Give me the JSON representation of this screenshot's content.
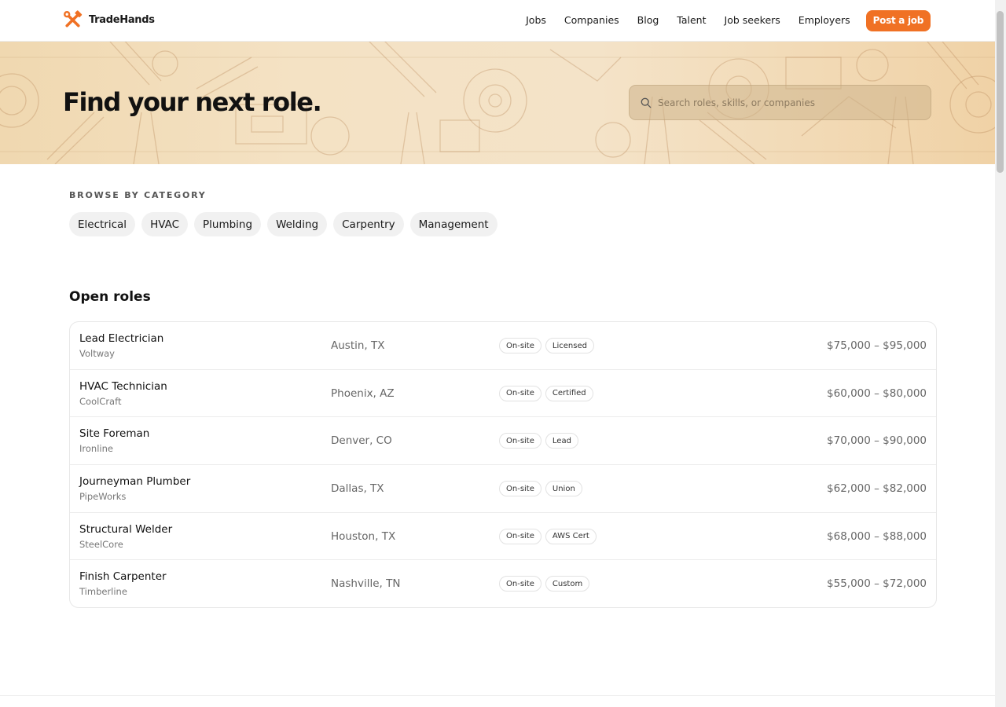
{
  "brand": {
    "name": "TradeHands",
    "accent": "#f07124"
  },
  "nav": {
    "links": [
      "Jobs",
      "Companies",
      "Blog",
      "Talent",
      "Job seekers",
      "Employers"
    ],
    "cta_label": "Post a job"
  },
  "hero": {
    "title": "Find your next role.",
    "search_placeholder": "Search roles, skills, or companies"
  },
  "categories": {
    "heading": "BROWSE BY CATEGORY",
    "items": [
      "Electrical",
      "HVAC",
      "Plumbing",
      "Welding",
      "Carpentry",
      "Management"
    ]
  },
  "roles": {
    "heading": "Open roles",
    "rows": [
      {
        "title": "Lead Electrician",
        "company": "Voltway",
        "location": "Austin, TX",
        "tags": [
          "On-site",
          "Licensed"
        ],
        "salary": "$75,000 – $95,000"
      },
      {
        "title": "HVAC Technician",
        "company": "CoolCraft",
        "location": "Phoenix, AZ",
        "tags": [
          "On-site",
          "Certified"
        ],
        "salary": "$60,000 – $80,000"
      },
      {
        "title": "Site Foreman",
        "company": "Ironline",
        "location": "Denver, CO",
        "tags": [
          "On-site",
          "Lead"
        ],
        "salary": "$70,000 – $90,000"
      },
      {
        "title": "Journeyman Plumber",
        "company": "PipeWorks",
        "location": "Dallas, TX",
        "tags": [
          "On-site",
          "Union"
        ],
        "salary": "$62,000 – $82,000"
      },
      {
        "title": "Structural Welder",
        "company": "SteelCore",
        "location": "Houston, TX",
        "tags": [
          "On-site",
          "AWS Cert"
        ],
        "salary": "$68,000 – $88,000"
      },
      {
        "title": "Finish Carpenter",
        "company": "Timberline",
        "location": "Nashville, TN",
        "tags": [
          "On-site",
          "Custom"
        ],
        "salary": "$55,000 – $72,000"
      }
    ]
  }
}
